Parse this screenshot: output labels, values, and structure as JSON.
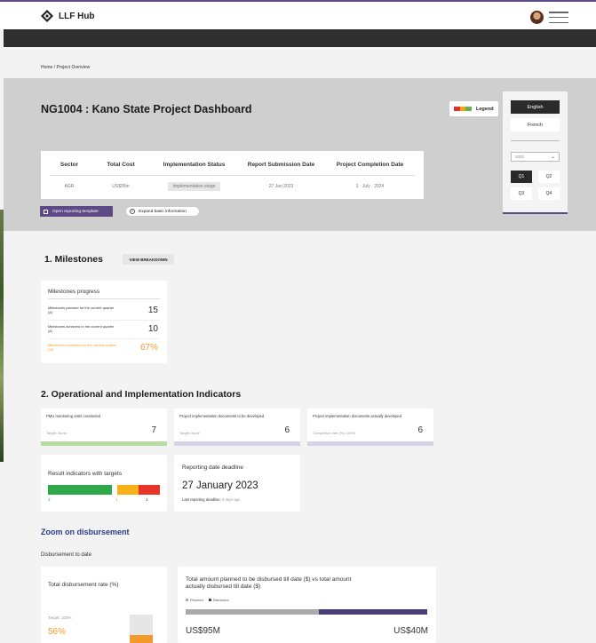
{
  "app": {
    "name": "LLF Hub"
  },
  "breadcrumb": {
    "text": "Home  /  Project Overview"
  },
  "page": {
    "title": "NG1004 : Kano State Project Dashboard"
  },
  "legend": {
    "label": "Legend",
    "colors": [
      "#d9342b",
      "#f2a51a",
      "#6ab04c"
    ]
  },
  "languages": {
    "english": "English",
    "french": "French"
  },
  "year_select": {
    "value": "2022"
  },
  "quarters": [
    "Q1",
    "Q2",
    "Q3",
    "Q4"
  ],
  "info": {
    "headers": [
      "Sector",
      "Total Cost",
      "Implementation Status",
      "Report Submission Date",
      "Project Completion Date"
    ],
    "values": [
      "AGR",
      "US$95m",
      "Implementation stage",
      "27 Jan 2023",
      "1 · July · 2024"
    ]
  },
  "actions": {
    "open_template": "Open reporting template",
    "expand": "Expand basic information"
  },
  "milestones": {
    "title": "1. Milestones",
    "view_breakdown": "VIEW BREAKDOWN",
    "card_title": "Milestones progress",
    "planned_label": "Milestones planned for the current quarter (#)",
    "planned_value": "15",
    "achieved_label": "Milestones achieved in the current quarter (#)",
    "achieved_value": "10",
    "completed_label": "Milestones completed in the current quarter (%)",
    "completed_value": "67%"
  },
  "indicators": {
    "title": "2. Operational and Implementation Indicators",
    "pmu": {
      "label": "PMU monitoring visits conducted",
      "sub": "Target: None",
      "value": "7"
    },
    "docs_dev": {
      "label": "Project implementation documents to be developed",
      "sub": "Target: None",
      "value": "6"
    },
    "docs_actual": {
      "label": "Project implementation documents actually developed",
      "sub": "Completion rate (%): 100%",
      "value": "6"
    },
    "result": {
      "label": "Result indicators with targets",
      "green": "3",
      "orange": "1",
      "red": "1",
      "green_share": 0.6,
      "orange_share": 0.2,
      "red_share": 0.2
    },
    "deadline": {
      "label": "Reporting date deadline",
      "date": "27 January 2023",
      "last": "Last reporting deadline:",
      "last_value": "9 days ago"
    }
  },
  "disbursement": {
    "zoom": "Zoom on disbursement",
    "to_date": "Disbursement to date",
    "rate_title": "Total disbursement rate (%)",
    "target": "Target: 100%",
    "rate_value": "56%",
    "rate_fraction": 0.56,
    "amount_title": "Total amount planned to be disbursed till date ($) vs total amount actually disbursed till date ($)",
    "legend_planned": "Planned",
    "legend_disbursed": "Disbursed",
    "planned": "US$95M",
    "disbursed": "US$40M",
    "planned_color": "#aaaaaa",
    "disbursed_color": "#4a3d78"
  },
  "colors": {
    "accent": "#5b4a86",
    "green": "#b9dca0",
    "lavender": "#d7d3e6",
    "orange": "#f39a2b",
    "red": "#e8332a",
    "bar_green": "#2ea84a"
  }
}
